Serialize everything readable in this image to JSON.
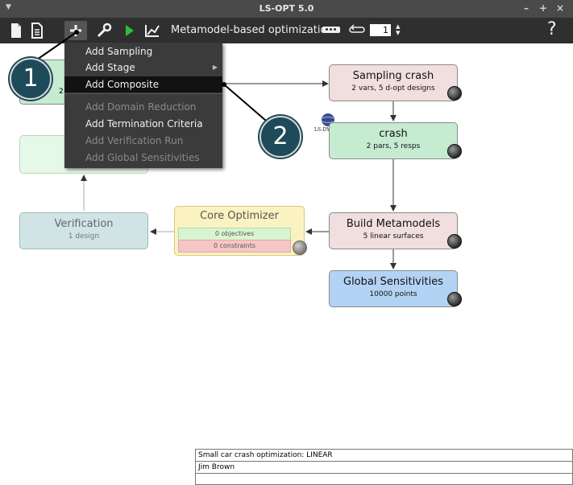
{
  "window": {
    "title": "LS-OPT 5.0",
    "controls": [
      "–",
      "+",
      "×"
    ]
  },
  "toolbar": {
    "title": "Metamodel-based optimization",
    "iterations": "1",
    "help_label": "?"
  },
  "menu": {
    "items": [
      {
        "label": "Add Sampling",
        "state": "enabled"
      },
      {
        "label": "Add Stage",
        "state": "enabled",
        "submenu": true
      },
      {
        "label": "Add Composite",
        "state": "highlighted"
      },
      {
        "label": "Add Domain Reduction",
        "state": "disabled"
      },
      {
        "label": "Add Termination Criteria",
        "state": "enabled"
      },
      {
        "label": "Add Verification Run",
        "state": "disabled"
      },
      {
        "label": "Add Global Sensitivities",
        "state": "disabled"
      }
    ]
  },
  "callouts": {
    "one": "1",
    "two": "2"
  },
  "nodes": {
    "sampling": {
      "title": "Sampling crash",
      "subtitle": "2 vars, 5 d-opt designs",
      "color": "#f1dede"
    },
    "crash": {
      "title": "crash",
      "subtitle": "2 pars, 5 resps",
      "color": "#c5ebd1"
    },
    "build": {
      "title": "Build Metamodels",
      "subtitle": "5 linear surfaces",
      "color": "#f1dede"
    },
    "global": {
      "title": "Global Sensitivities",
      "subtitle": "10000 points",
      "color": "#b3d3f4"
    },
    "optimizer": {
      "title": "Core Optimizer",
      "objectives": "0 objectives",
      "constraints": "0 constraints",
      "color": "#fbf2c1"
    },
    "verification": {
      "title": "Verification",
      "subtitle": "1 design",
      "color": "#d0e4e6"
    },
    "left_partial": {
      "subtitle_fragment": "2"
    }
  },
  "solver_logo": {
    "label": "LS-DYNA"
  },
  "info": {
    "description": "Small car crash optimization: LINEAR",
    "author": "Jim Brown",
    "notes": ""
  }
}
